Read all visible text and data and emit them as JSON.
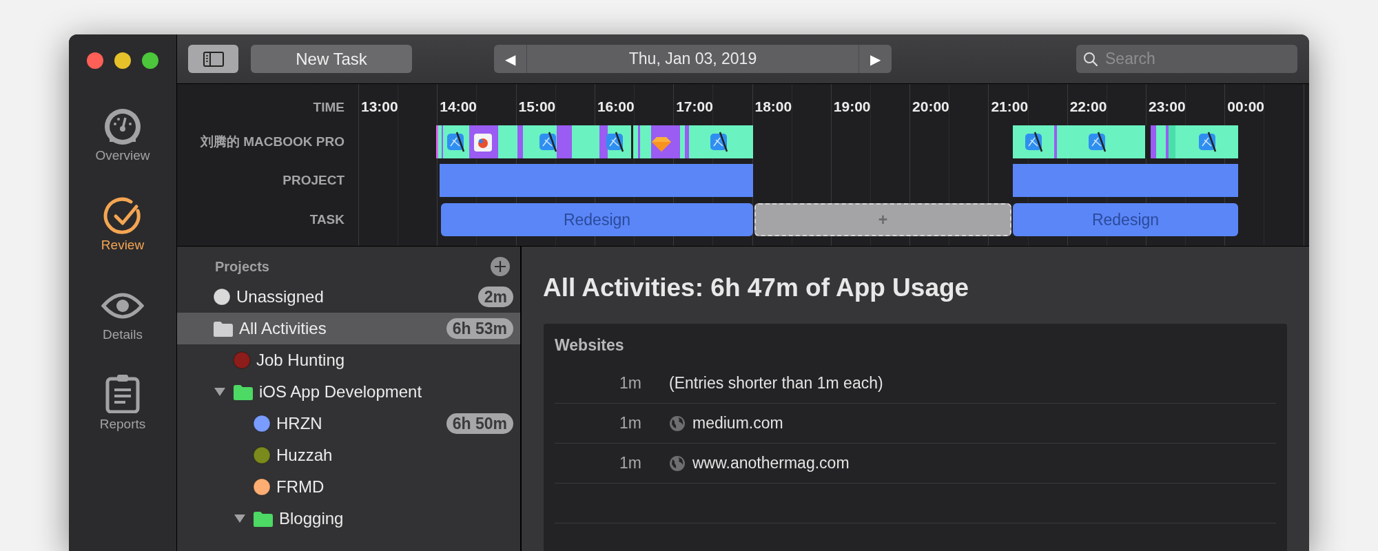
{
  "sidebar": {
    "items": [
      {
        "kind": "overview",
        "label": "Overview",
        "selected": false
      },
      {
        "kind": "review",
        "label": "Review",
        "selected": true
      },
      {
        "kind": "details",
        "label": "Details",
        "selected": false
      },
      {
        "kind": "reports",
        "label": "Reports",
        "selected": false
      }
    ]
  },
  "toolbar": {
    "new_task": "New Task",
    "date": "Thu, Jan 03, 2019",
    "prev": "◀",
    "next": "▶",
    "search": {
      "placeholder": "Search"
    }
  },
  "timeline": {
    "row_labels": [
      "TIME",
      "刘腾的 MACBOOK PRO",
      "PROJECT",
      "TASK"
    ],
    "hours": [
      "13:00",
      "14:00",
      "15:00",
      "16:00",
      "17:00",
      "18:00",
      "19:00",
      "20:00",
      "21:00",
      "22:00",
      "23:00",
      "00:00"
    ],
    "tasks": [
      {
        "kind": "task",
        "label": "Redesign"
      },
      {
        "kind": "placeholder",
        "label": "+"
      },
      {
        "kind": "task",
        "label": "Redesign"
      }
    ]
  },
  "projects": {
    "title": "Projects",
    "items": [
      {
        "kind": "dot",
        "name": "Unassigned",
        "color": "#d9d9d9",
        "badge": "2m",
        "selected": false
      },
      {
        "kind": "folder",
        "name": "All Activities",
        "color": "#d0d0d2",
        "badge": "6h 53m",
        "selected": true,
        "children": [
          {
            "kind": "dot",
            "name": "Job Hunting",
            "color": "#8c1d1a",
            "selected": false
          },
          {
            "kind": "folder",
            "name": "iOS App Development",
            "color": "#4cd964",
            "expanded": true,
            "selected": false,
            "children": [
              {
                "kind": "dot",
                "name": "HRZN",
                "color": "#7a9cff",
                "badge": "6h 50m",
                "selected": false
              },
              {
                "kind": "dot",
                "name": "Huzzah",
                "color": "#7b8a1c",
                "selected": false
              },
              {
                "kind": "dot",
                "name": "FRMD",
                "color": "#ffae73",
                "selected": false
              },
              {
                "kind": "folder",
                "name": "Blogging",
                "color": "#4cd964",
                "expanded": true,
                "selected": false
              }
            ]
          }
        ]
      }
    ]
  },
  "main": {
    "title": "All Activities: 6h 47m of App Usage",
    "card": {
      "title": "Websites",
      "rows": [
        {
          "kind": "note",
          "duration": "1m",
          "label": "(Entries shorter than 1m each)"
        },
        {
          "kind": "site",
          "duration": "1m",
          "label": "medium.com"
        },
        {
          "kind": "site",
          "duration": "1m",
          "label": "www.anothermag.com"
        }
      ]
    }
  }
}
